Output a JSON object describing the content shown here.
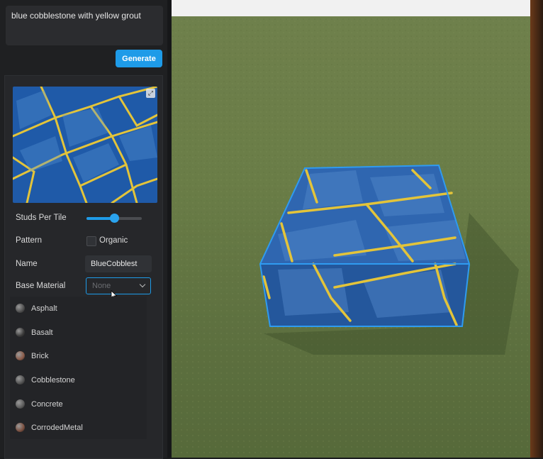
{
  "prompt": {
    "text": "blue cobblestone with yellow grout"
  },
  "generate_button": {
    "label": "Generate"
  },
  "properties": {
    "studs_per_tile": {
      "label": "Studs Per Tile",
      "value": 0.5
    },
    "pattern": {
      "label": "Pattern",
      "option_label": "Organic",
      "checked": false
    },
    "name": {
      "label": "Name",
      "value": "BlueCobblest"
    },
    "base_material": {
      "label": "Base Material",
      "value": "None"
    }
  },
  "dropdown": {
    "items": [
      {
        "label": "Asphalt",
        "color": "#4d4d4d"
      },
      {
        "label": "Basalt",
        "color": "#3a3a3a"
      },
      {
        "label": "Brick",
        "color": "#8a5a48"
      },
      {
        "label": "Cobblestone",
        "color": "#505050"
      },
      {
        "label": "Concrete",
        "color": "#5a5a5a"
      },
      {
        "label": "CorrodedMetal",
        "color": "#7a4e3e"
      }
    ]
  },
  "colors": {
    "accent": "#1e9be8",
    "selection_outline": "#2f9bf0",
    "material_blue": "#2f66b0",
    "grout_yellow": "#e3c43a"
  }
}
